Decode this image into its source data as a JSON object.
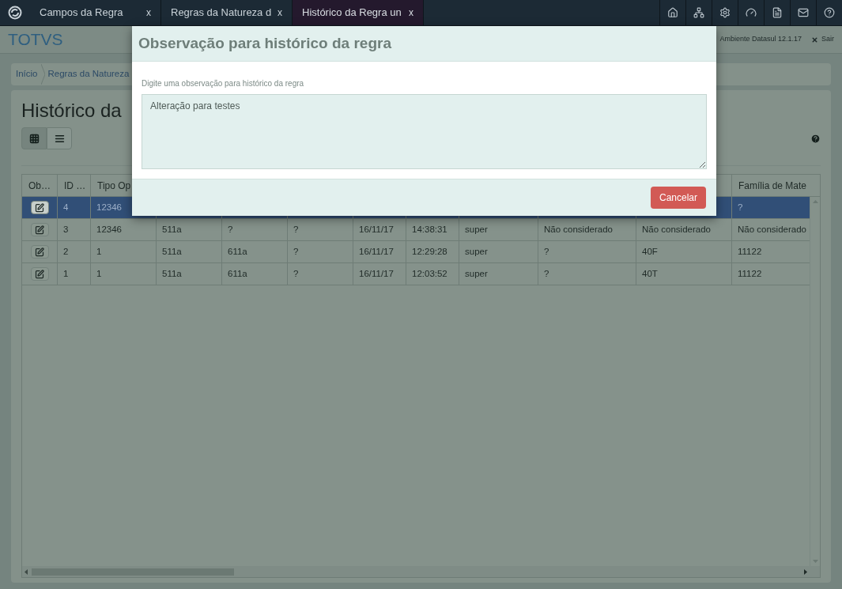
{
  "tabs": [
    {
      "label": "Campos da Regra",
      "close": "x",
      "selected": false
    },
    {
      "label": "Regras da Natureza d",
      "close": "x",
      "selected": false
    },
    {
      "label": "Histórico da Regra un",
      "close": "x",
      "selected": true
    }
  ],
  "header": {
    "brand": "TOTVS",
    "environment": "Ambiente Datasul 12.1.17",
    "logout": "Sair"
  },
  "breadcrumb": [
    "Início",
    "Regras da Natureza"
  ],
  "page_title": "Histórico da",
  "view_toggle": [
    {
      "kind": "grid",
      "selected": true
    },
    {
      "kind": "list",
      "selected": false
    }
  ],
  "table": {
    "columns": [
      "Ob…",
      "ID …",
      "Tipo Op",
      null,
      null,
      null,
      null,
      null,
      null,
      null,
      null,
      "Família de Mate"
    ],
    "rows": [
      {
        "selected": true,
        "cells": [
          "",
          "4",
          "12346",
          null,
          null,
          null,
          null,
          null,
          null,
          null,
          null,
          "?"
        ]
      },
      {
        "selected": false,
        "cells": [
          "",
          "3",
          "12346",
          "511a",
          "?",
          "?",
          "16/11/17",
          "14:38:31",
          "super",
          "Não considerado",
          "Não considerado",
          "Não considerado"
        ]
      },
      {
        "selected": false,
        "cells": [
          "",
          "2",
          "1",
          "511a",
          "611a",
          "?",
          "16/11/17",
          "12:29:28",
          "super",
          "?",
          "40F",
          "11122"
        ]
      },
      {
        "selected": false,
        "cells": [
          "",
          "1",
          "1",
          "511a",
          "611a",
          "?",
          "16/11/17",
          "12:03:52",
          "super",
          "?",
          "40T",
          "11122"
        ]
      }
    ]
  },
  "dialog": {
    "title": "Observação para histórico da regra",
    "field_label": "Digite uma observação para histórico da regra",
    "value": "Alteração para testes",
    "buttons": [
      "Cancelar"
    ]
  }
}
